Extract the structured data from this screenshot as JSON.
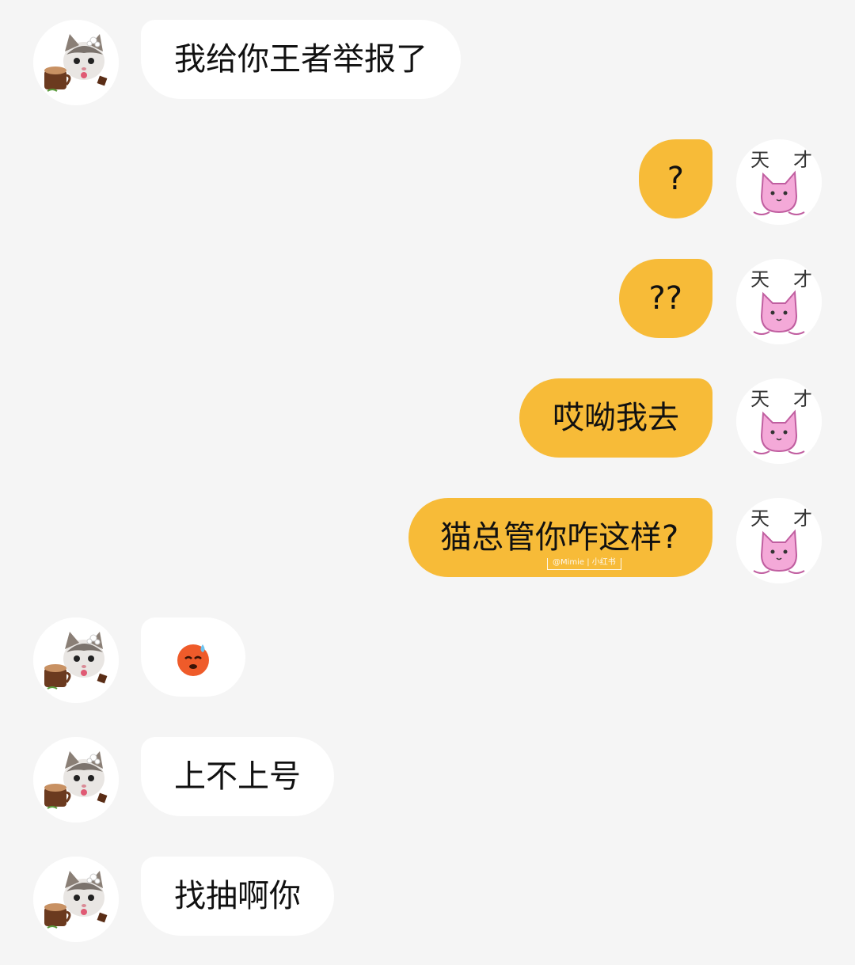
{
  "colors": {
    "background": "#f5f5f5",
    "incoming_bubble": "#ffffff",
    "outgoing_bubble": "#f7bb38",
    "text": "#111111"
  },
  "messages": [
    {
      "direction": "incoming",
      "avatar": "cat-latte-avatar",
      "text": "我给你王者举报了"
    },
    {
      "direction": "outgoing",
      "avatar": "pink-cat-tiancai-avatar",
      "avatar_text": "天 才",
      "text": "?"
    },
    {
      "direction": "outgoing",
      "avatar": "pink-cat-tiancai-avatar",
      "avatar_text": "天 才",
      "text": "??"
    },
    {
      "direction": "outgoing",
      "avatar": "pink-cat-tiancai-avatar",
      "avatar_text": "天 才",
      "text": "哎呦我去"
    },
    {
      "direction": "outgoing",
      "avatar": "pink-cat-tiancai-avatar",
      "avatar_text": "天 才",
      "text": "猫总管你咋这样?",
      "watermark": "@Mimie | 小红书"
    },
    {
      "direction": "incoming",
      "avatar": "cat-latte-avatar",
      "emoji": "sweating-angry-face-emoji"
    },
    {
      "direction": "incoming",
      "avatar": "cat-latte-avatar",
      "text": "上不上号"
    },
    {
      "direction": "incoming",
      "avatar": "cat-latte-avatar",
      "text": "找抽啊你"
    }
  ]
}
